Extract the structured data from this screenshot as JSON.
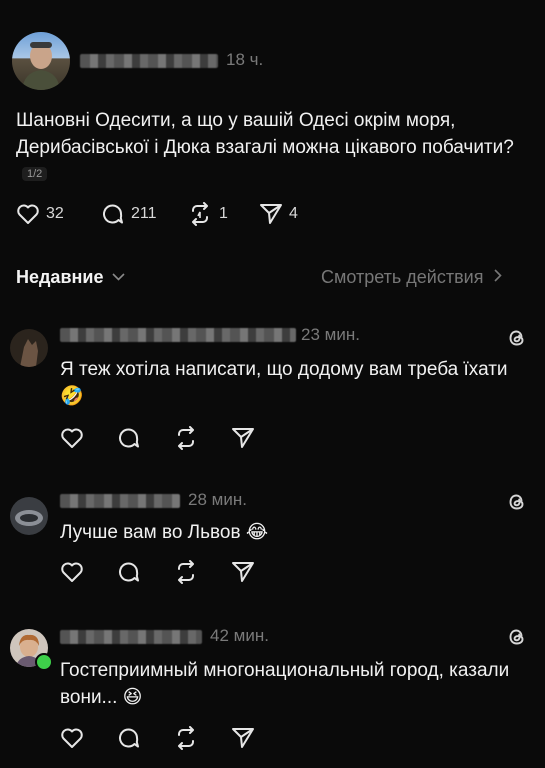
{
  "post": {
    "time": "18 ч.",
    "text": "Шановні Одесити, а що у вашій Одесі окрім моря, Дерибасівської і Дюка взагалі можна цікавого побачити?",
    "page_badge": "1/2",
    "likes": "32",
    "replies": "211",
    "reposts": "1",
    "shares": "4"
  },
  "sort": {
    "label": "Недавние",
    "activity_link": "Смотреть действия"
  },
  "comments": [
    {
      "time": "23 мин.",
      "text": "Я теж хотіла написати, що додому вам треба їхати 🤣"
    },
    {
      "time": "28 мин.",
      "text": "Лучше вам во Львов 😂"
    },
    {
      "time": "42 мин.",
      "text": "Гостеприимный многонациональный город, казали вони... 😆"
    }
  ],
  "colors": {
    "background": "#0a0a0a",
    "online_dot": "#3ecf4a"
  }
}
